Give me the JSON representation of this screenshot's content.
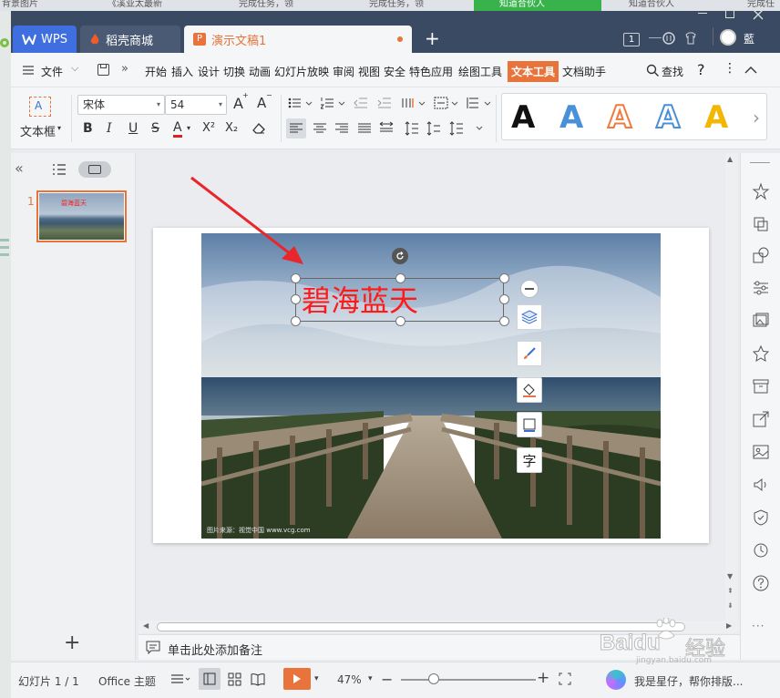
{
  "browser_tabs": [
    "背景图片",
    "《溪亚太最新",
    "完成任务，领",
    "完成任务，领",
    "知道合伙人",
    "知道合伙人",
    "完成任"
  ],
  "titlebar": {
    "tabs": [
      {
        "label": "WPS"
      },
      {
        "label": "稻壳商城"
      },
      {
        "label": "演示文稿1"
      }
    ],
    "new_tab": "+",
    "badge": "1",
    "user_initial": "藍"
  },
  "menubar": {
    "file": "文件",
    "items": [
      "开始",
      "插入",
      "设计",
      "切换",
      "动画",
      "幻灯片放映",
      "审阅",
      "视图",
      "安全",
      "特色应用",
      "绘图工具",
      "文本工具",
      "文档助手"
    ],
    "active": "文本工具",
    "search": "查找",
    "help": "?"
  },
  "ribbon": {
    "textbox_label": "文本框",
    "font_name": "宋体",
    "font_size": "54",
    "grow_font": "A",
    "shrink_font": "A",
    "bold": "B",
    "italic": "I",
    "underline": "U",
    "strike": "S",
    "font_color": "A",
    "superscript": "X²",
    "subscript": "X₂",
    "art_styles": [
      {
        "glyph": "A",
        "color": "#111111",
        "style": "solid"
      },
      {
        "glyph": "A",
        "color": "#4a90d9",
        "style": "solid"
      },
      {
        "glyph": "A",
        "color": "#f07b3f",
        "style": "outline"
      },
      {
        "glyph": "A",
        "color": "#4a90d9",
        "style": "outline"
      },
      {
        "glyph": "A",
        "color": "#f2b705",
        "style": "solid"
      }
    ]
  },
  "left_panel": {
    "collapse": "«",
    "slide_number": "1",
    "add_slide": "+"
  },
  "slide": {
    "title_text": "碧海蓝天",
    "title_color": "#ff1a1a",
    "photo_credit": "图片来源：视觉中国 www.vcg.com"
  },
  "float_toolbar": [
    "collapse-icon",
    "layers-icon",
    "brush-icon",
    "fill-icon",
    "border-icon",
    "text-icon"
  ],
  "float_text_glyph": "字",
  "notes": {
    "placeholder": "单击此处添加备注"
  },
  "statusbar": {
    "slide_info": "幻灯片 1 / 1",
    "theme": "Office 主题",
    "zoom": "47%",
    "zoom_minus": "−",
    "zoom_plus": "+",
    "assistant_text": "我是星仔，帮你排版..."
  },
  "watermark": {
    "brand": "Baidu",
    "suffix": "经验",
    "url": "jingyan.baidu.com"
  },
  "colors": {
    "accent": "#e8743b",
    "titlebar": "#3b4a63",
    "active_tab": "#f5f6f7"
  }
}
